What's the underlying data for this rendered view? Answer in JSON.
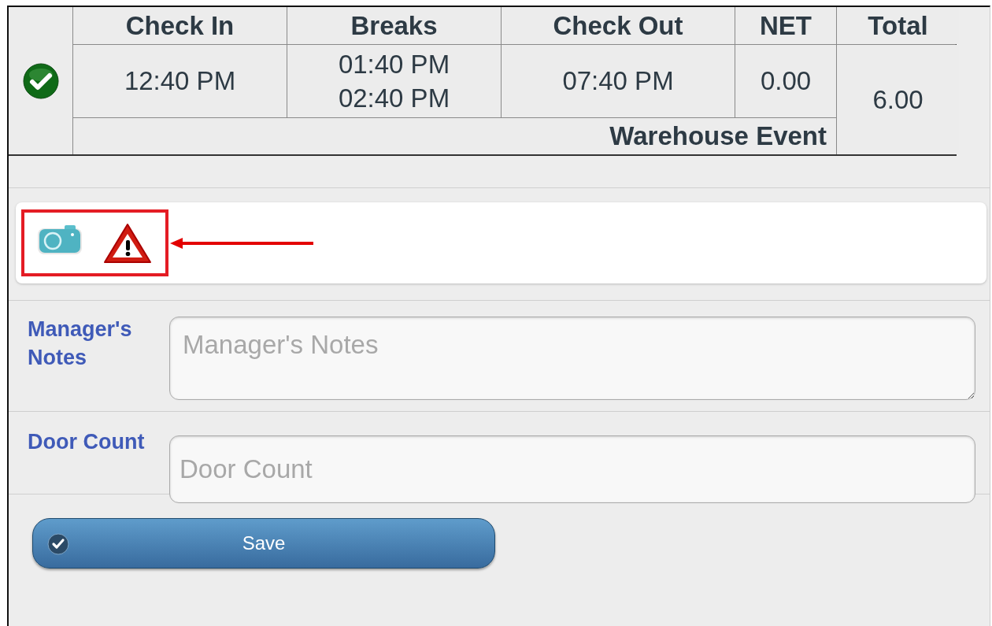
{
  "table": {
    "columns": [
      "Check In",
      "Breaks",
      "Check Out",
      "NET",
      "Total"
    ],
    "check_in": "12:40 PM",
    "breaks": [
      "01:40 PM",
      "02:40 PM"
    ],
    "check_out": "07:40 PM",
    "net": "0.00",
    "total": "6.00",
    "event": "Warehouse Event"
  },
  "fields": [
    {
      "label": "Manager's Notes",
      "placeholder": "Manager's Notes",
      "kind": "textarea"
    },
    {
      "label": "Door Count",
      "placeholder": "Door Count",
      "kind": "input"
    }
  ],
  "save_button": {
    "label": "Save"
  }
}
